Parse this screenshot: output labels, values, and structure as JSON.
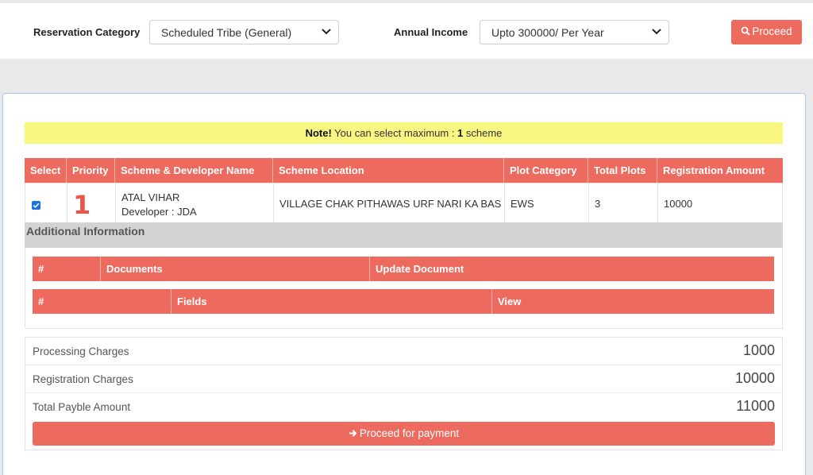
{
  "filters": {
    "reservation_label": "Reservation Category",
    "reservation_value": "Scheduled Tribe (General)",
    "income_label": "Annual Income",
    "income_value": "Upto 300000/ Per Year",
    "proceed_label": "Proceed"
  },
  "note": {
    "prefix": "Note!",
    "text": " You can select maximum : ",
    "count": "1",
    "suffix": " scheme"
  },
  "scheme_table": {
    "headers": [
      "Select",
      "Priority",
      "Scheme & Developer Name",
      "Scheme Location",
      "Plot Category",
      "Total Plots",
      "Registration Amount"
    ],
    "row": {
      "selected": true,
      "priority": "1",
      "scheme_name": "ATAL VIHAR",
      "developer": "Developer : JDA",
      "location": "VILLAGE CHAK PITHAWAS URF NARI KA BAS",
      "plot_category": "EWS",
      "total_plots": "3",
      "registration_amount": "10000"
    }
  },
  "additional_info": {
    "title": "Additional Information",
    "documents_headers": [
      "#",
      "Documents",
      "Update Document"
    ],
    "fields_headers": [
      "#",
      "Fields",
      "View"
    ]
  },
  "summary": {
    "rows": [
      {
        "label": "Processing Charges",
        "value": "1000"
      },
      {
        "label": "Registration Charges",
        "value": "10000"
      },
      {
        "label": "Total Payble Amount",
        "value": "11000"
      }
    ],
    "pay_button_label": "Proceed for payment"
  },
  "colors": {
    "accent": "#ec6b5e",
    "note_bg": "#f7f781",
    "priority": "#e8564a"
  }
}
